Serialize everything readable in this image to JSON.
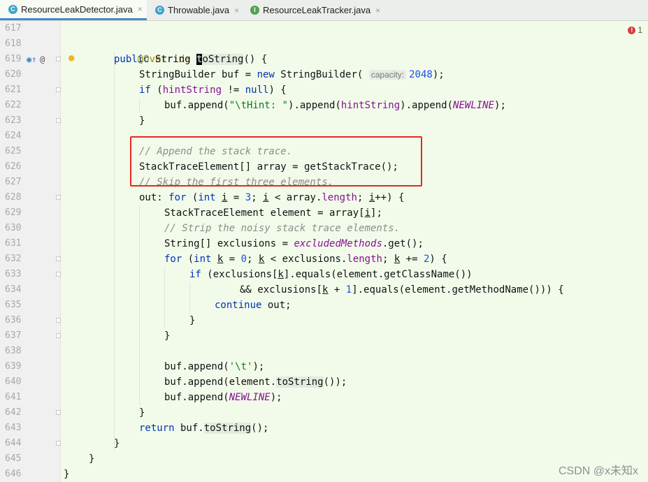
{
  "tabs": [
    {
      "label": "ResourceLeakDetector.java",
      "icon": "C",
      "close": "×"
    },
    {
      "label": "Throwable.java",
      "icon": "C",
      "close": "×"
    },
    {
      "label": "ResourceLeakTracker.java",
      "icon": "I",
      "close": "×"
    }
  ],
  "colors": {
    "class_icon": "#3ea3c9",
    "interface_icon": "#52a352",
    "highlight_box": "#e8281f"
  },
  "error_count": "1",
  "line_numbers": [
    "617",
    "618",
    "619",
    "620",
    "621",
    "622",
    "623",
    "624",
    "625",
    "626",
    "627",
    "628",
    "629",
    "630",
    "631",
    "632",
    "633",
    "634",
    "635",
    "636",
    "637",
    "638",
    "639",
    "640",
    "641",
    "642",
    "643",
    "644",
    "645",
    "646"
  ],
  "code": {
    "l618_ann": "@Override",
    "l619_kw": "public",
    "l619_a": " String ",
    "l619_caret": "t",
    "l619_b": "oString",
    "l619_c": "() {",
    "l620_a": "StringBuilder buf = ",
    "l620_kw": "new",
    "l620_b": " StringBuilder( ",
    "l620_hint": "capacity:",
    "l620_num": "2048",
    "l620_c": ");",
    "l621_kw": "if",
    "l621_a": " (",
    "l621_fld": "hintString",
    "l621_b": " != ",
    "l621_kw2": "null",
    "l621_c": ") {",
    "l622_a": "buf.append(",
    "l622_str": "\"\\tHint: \"",
    "l622_b": ").append(",
    "l622_fld": "hintString",
    "l622_c": ").append(",
    "l622_sfld": "NEWLINE",
    "l622_d": ");",
    "l623": "}",
    "l625_cmt": "// Append the stack trace.",
    "l626": "StackTraceElement[] array = getStackTrace();",
    "l627_cmt": "// Skip the first three elements.",
    "l628_a": "out: ",
    "l628_kw": "for",
    "l628_b": " (",
    "l628_kw2": "int",
    "l628_c": " ",
    "l628_i1": "i",
    "l628_d": " = ",
    "l628_num": "3",
    "l628_e": "; ",
    "l628_i2": "i",
    "l628_f": " < array.",
    "l628_fld": "length",
    "l628_g": "; ",
    "l628_i3": "i",
    "l628_h": "++) {",
    "l629_a": "StackTraceElement element = array[",
    "l629_i": "i",
    "l629_b": "];",
    "l630_cmt": "// Strip the noisy stack trace elements.",
    "l631_a": "String[] exclusions = ",
    "l631_sfld": "excludedMethods",
    "l631_b": ".get();",
    "l632_kw": "for",
    "l632_a": " (",
    "l632_kw2": "int",
    "l632_b": " ",
    "l632_k1": "k",
    "l632_c": " = ",
    "l632_num": "0",
    "l632_d": "; ",
    "l632_k2": "k",
    "l632_e": " < exclusions.",
    "l632_fld": "length",
    "l632_f": "; ",
    "l632_k3": "k",
    "l632_g": " += ",
    "l632_num2": "2",
    "l632_h": ") {",
    "l633_kw": "if",
    "l633_a": " (exclusions[",
    "l633_k": "k",
    "l633_b": "].equals(element.getClassName())",
    "l634_a": "&& exclusions[",
    "l634_k": "k",
    "l634_b": " + ",
    "l634_num": "1",
    "l634_c": "].equals(element.getMethodName())) {",
    "l635_kw": "continue",
    "l635_a": " out;",
    "l636": "}",
    "l637": "}",
    "l639_a": "buf.append(",
    "l639_str": "'\\t'",
    "l639_b": ");",
    "l640_a": "buf.append(element.",
    "l640_m": "toString",
    "l640_b": "());",
    "l641_a": "buf.append(",
    "l641_sfld": "NEWLINE",
    "l641_b": ");",
    "l642": "}",
    "l643_kw": "return",
    "l643_a": " buf.",
    "l643_m": "toString",
    "l643_b": "();",
    "l644": "}",
    "l645": "}",
    "l646": "}"
  },
  "watermark": "CSDN @x未知x"
}
